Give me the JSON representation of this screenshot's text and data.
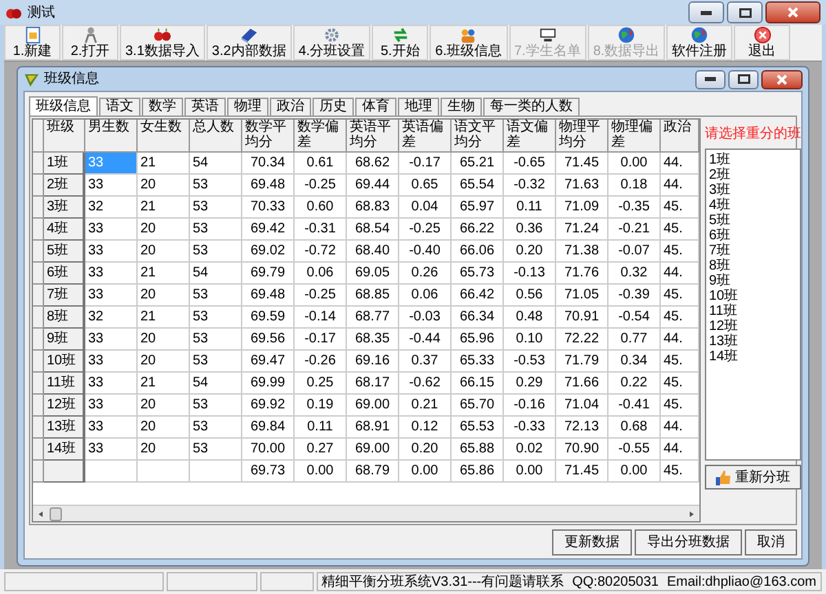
{
  "window": {
    "title": "测试"
  },
  "toolbar": [
    {
      "label": "1.新建",
      "disabled": false
    },
    {
      "label": "2.打开",
      "disabled": false
    },
    {
      "label": "3.1数据导入",
      "disabled": false
    },
    {
      "label": "3.2内部数据",
      "disabled": false
    },
    {
      "label": "4.分班设置",
      "disabled": false
    },
    {
      "label": "5.开始",
      "disabled": false
    },
    {
      "label": "6.班级信息",
      "disabled": false
    },
    {
      "label": "7.学生名单",
      "disabled": true
    },
    {
      "label": "8.数据导出",
      "disabled": true
    },
    {
      "label": "软件注册",
      "disabled": false
    },
    {
      "label": "退出",
      "disabled": false
    }
  ],
  "child_window": {
    "title": "班级信息",
    "tabs": [
      {
        "label": "班级信息",
        "selected": true
      },
      {
        "label": "语文",
        "selected": false
      },
      {
        "label": "数学",
        "selected": false
      },
      {
        "label": "英语",
        "selected": false
      },
      {
        "label": "物理",
        "selected": false
      },
      {
        "label": "政治",
        "selected": false
      },
      {
        "label": "历史",
        "selected": false
      },
      {
        "label": "体育",
        "selected": false
      },
      {
        "label": "地理",
        "selected": false
      },
      {
        "label": "生物",
        "selected": false
      },
      {
        "label": "每一类的人数",
        "selected": false
      }
    ],
    "table": {
      "columns": [
        "班级",
        "男生数",
        "女生数",
        "总人数",
        "数学平均分",
        "数学偏差",
        "英语平均分",
        "英语偏差",
        "语文平均分",
        "语文偏差",
        "物理平均分",
        "物理偏差",
        "政治"
      ],
      "rows": [
        {
          "label": "1班",
          "counts": [
            "33",
            "21",
            "54"
          ],
          "values": [
            "70.34",
            "0.61",
            "68.62",
            "-0.17",
            "65.21",
            "-0.65",
            "71.45",
            "0.00",
            "44."
          ],
          "selected": true
        },
        {
          "label": "2班",
          "counts": [
            "33",
            "20",
            "53"
          ],
          "values": [
            "69.48",
            "-0.25",
            "69.44",
            "0.65",
            "65.54",
            "-0.32",
            "71.63",
            "0.18",
            "44."
          ],
          "selected": false
        },
        {
          "label": "3班",
          "counts": [
            "32",
            "21",
            "53"
          ],
          "values": [
            "70.33",
            "0.60",
            "68.83",
            "0.04",
            "65.97",
            "0.11",
            "71.09",
            "-0.35",
            "45."
          ],
          "selected": false
        },
        {
          "label": "4班",
          "counts": [
            "33",
            "20",
            "53"
          ],
          "values": [
            "69.42",
            "-0.31",
            "68.54",
            "-0.25",
            "66.22",
            "0.36",
            "71.24",
            "-0.21",
            "45."
          ],
          "selected": false
        },
        {
          "label": "5班",
          "counts": [
            "33",
            "20",
            "53"
          ],
          "values": [
            "69.02",
            "-0.72",
            "68.40",
            "-0.40",
            "66.06",
            "0.20",
            "71.38",
            "-0.07",
            "45."
          ],
          "selected": false
        },
        {
          "label": "6班",
          "counts": [
            "33",
            "21",
            "54"
          ],
          "values": [
            "69.79",
            "0.06",
            "69.05",
            "0.26",
            "65.73",
            "-0.13",
            "71.76",
            "0.32",
            "44."
          ],
          "selected": false
        },
        {
          "label": "7班",
          "counts": [
            "33",
            "20",
            "53"
          ],
          "values": [
            "69.48",
            "-0.25",
            "68.85",
            "0.06",
            "66.42",
            "0.56",
            "71.05",
            "-0.39",
            "45."
          ],
          "selected": false
        },
        {
          "label": "8班",
          "counts": [
            "32",
            "21",
            "53"
          ],
          "values": [
            "69.59",
            "-0.14",
            "68.77",
            "-0.03",
            "66.34",
            "0.48",
            "70.91",
            "-0.54",
            "45."
          ],
          "selected": false
        },
        {
          "label": "9班",
          "counts": [
            "33",
            "20",
            "53"
          ],
          "values": [
            "69.56",
            "-0.17",
            "68.35",
            "-0.44",
            "65.96",
            "0.10",
            "72.22",
            "0.77",
            "44."
          ],
          "selected": false
        },
        {
          "label": "10班",
          "counts": [
            "33",
            "20",
            "53"
          ],
          "values": [
            "69.47",
            "-0.26",
            "69.16",
            "0.37",
            "65.33",
            "-0.53",
            "71.79",
            "0.34",
            "45."
          ],
          "selected": false
        },
        {
          "label": "11班",
          "counts": [
            "33",
            "21",
            "54"
          ],
          "values": [
            "69.99",
            "0.25",
            "68.17",
            "-0.62",
            "66.15",
            "0.29",
            "71.66",
            "0.22",
            "45."
          ],
          "selected": false
        },
        {
          "label": "12班",
          "counts": [
            "33",
            "20",
            "53"
          ],
          "values": [
            "69.92",
            "0.19",
            "69.00",
            "0.21",
            "65.70",
            "-0.16",
            "71.04",
            "-0.41",
            "45."
          ],
          "selected": false
        },
        {
          "label": "13班",
          "counts": [
            "33",
            "20",
            "53"
          ],
          "values": [
            "69.84",
            "0.11",
            "68.91",
            "0.12",
            "65.53",
            "-0.33",
            "72.13",
            "0.68",
            "44."
          ],
          "selected": false
        },
        {
          "label": "14班",
          "counts": [
            "33",
            "20",
            "53"
          ],
          "values": [
            "70.00",
            "0.27",
            "69.00",
            "0.20",
            "65.88",
            "0.02",
            "70.90",
            "-0.55",
            "44."
          ],
          "selected": false
        },
        {
          "values": [
            "69.73",
            "0.00",
            "68.79",
            "0.00",
            "65.86",
            "0.00",
            "71.45",
            "0.00",
            "45."
          ],
          "selected": false
        }
      ]
    },
    "side_panel": {
      "prompt": "请选择重分的班",
      "classes": [
        "1班",
        "2班",
        "3班",
        "4班",
        "5班",
        "6班",
        "7班",
        "8班",
        "9班",
        "10班",
        "11班",
        "12班",
        "13班",
        "14班"
      ],
      "button": "重新分班"
    },
    "buttons": [
      "更新数据",
      "导出分班数据",
      "取消"
    ]
  },
  "status_bar": [
    "精细平衡分班系统V3.31---有问题请联系",
    "QQ:80205031",
    "Email:dhpliao@163.com"
  ]
}
